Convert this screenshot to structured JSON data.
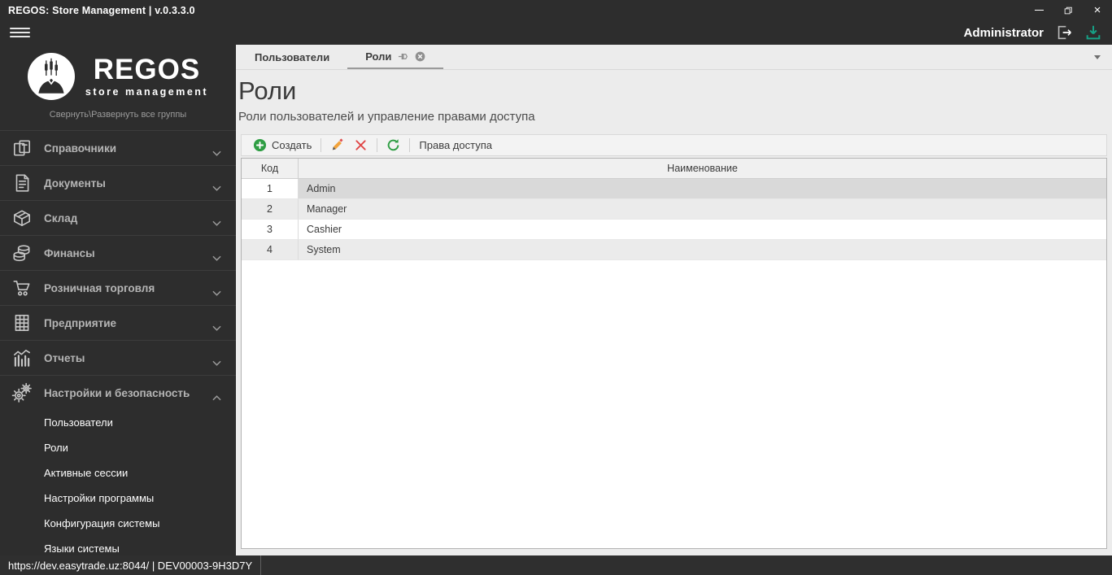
{
  "window": {
    "title": "REGOS: Store Management | v.0.3.3.0"
  },
  "header": {
    "user": "Administrator"
  },
  "sidebar": {
    "logo_title": "REGOS",
    "logo_subtitle": "store management",
    "collapse_hint": "Свернуть\\Развернуть все группы",
    "groups": [
      {
        "name": "references",
        "icon": "catalog",
        "label": "Справочники",
        "expanded": false
      },
      {
        "name": "documents",
        "icon": "document",
        "label": "Документы",
        "expanded": false
      },
      {
        "name": "warehouse",
        "icon": "box",
        "label": "Склад",
        "expanded": false
      },
      {
        "name": "finance",
        "icon": "coins",
        "label": "Финансы",
        "expanded": false
      },
      {
        "name": "retail",
        "icon": "cart",
        "label": "Розничная торговля",
        "expanded": false
      },
      {
        "name": "enterprise",
        "icon": "building",
        "label": "Предприятие",
        "expanded": false
      },
      {
        "name": "reports",
        "icon": "chart",
        "label": "Отчеты",
        "expanded": false
      },
      {
        "name": "settings-security",
        "icon": "gears",
        "label": "Настройки и безопасность",
        "expanded": true,
        "children": [
          {
            "name": "users",
            "label": "Пользователи"
          },
          {
            "name": "roles",
            "label": "Роли"
          },
          {
            "name": "active-sessions",
            "label": "Активные сессии"
          },
          {
            "name": "program-settings",
            "label": "Настройки программы"
          },
          {
            "name": "system-configuration",
            "label": "Конфигурация системы"
          },
          {
            "name": "system-languages",
            "label": "Языки системы"
          }
        ]
      }
    ]
  },
  "main": {
    "tabs": [
      {
        "label": "Пользователи",
        "active": false
      },
      {
        "label": "Роли",
        "active": true
      }
    ],
    "page": {
      "title": "Роли",
      "subtitle": "Роли пользователей и управление правами доступа"
    },
    "toolbar": {
      "create_label": "Создать",
      "access_rights_label": "Права доступа"
    },
    "table": {
      "columns": [
        "Код",
        "Наименование"
      ],
      "rows": [
        {
          "code": "1",
          "name": "Admin",
          "selected": true
        },
        {
          "code": "2",
          "name": "Manager",
          "selected": false
        },
        {
          "code": "3",
          "name": "Cashier",
          "selected": false
        },
        {
          "code": "4",
          "name": "System",
          "selected": false
        }
      ]
    }
  },
  "status_bar": {
    "text": "https://dev.easytrade.uz:8044/ | DEV00003-9H3D7Y"
  },
  "colors": {
    "create_green": "#2f9e44",
    "refresh_green": "#2f9e44",
    "delete_red": "#e04545",
    "edit_orange": "#f2a33c",
    "download_teal": "#16a085",
    "sidebar_dark": "#2d2d2d",
    "selection_gray": "#d9d9d9"
  }
}
